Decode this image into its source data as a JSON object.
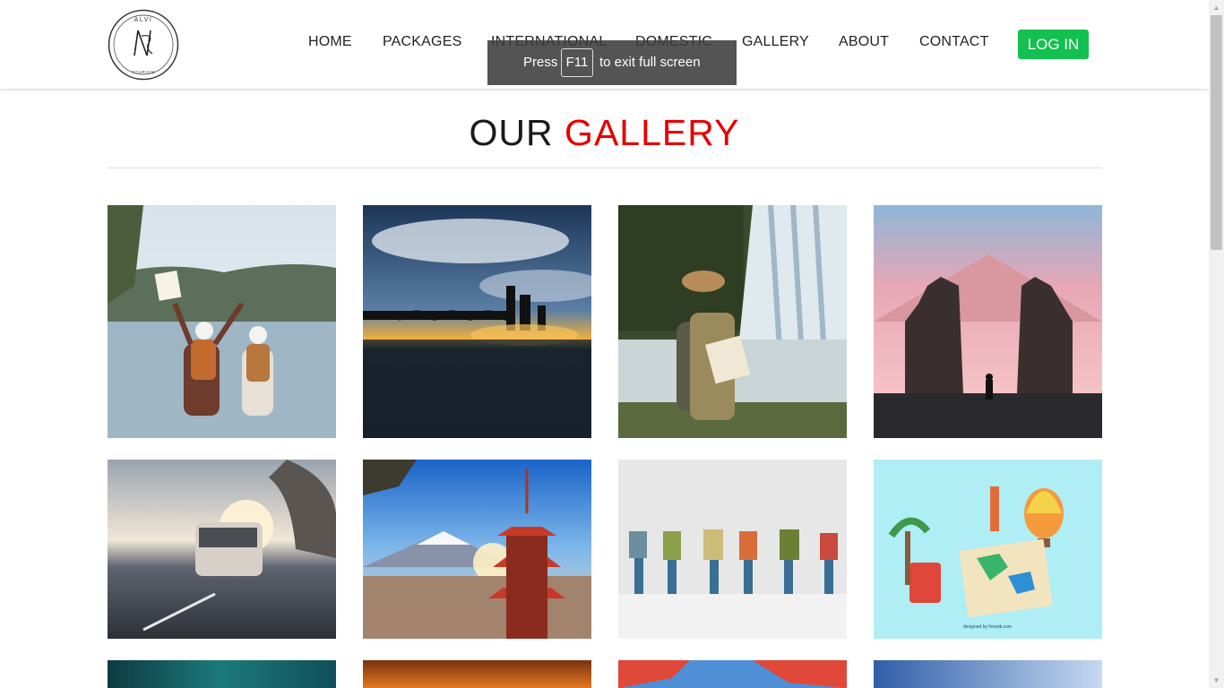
{
  "brand": {
    "logo_top_text": "ALVI",
    "logo_bottom_text": "TOURISM"
  },
  "nav": {
    "items": [
      {
        "label": "HOME"
      },
      {
        "label": "PACKAGES"
      },
      {
        "label": "INTERNATIONAL"
      },
      {
        "label": "DOMESTIC"
      },
      {
        "label": "GALLERY"
      },
      {
        "label": "ABOUT"
      },
      {
        "label": "CONTACT"
      }
    ],
    "login_label": "LOG IN"
  },
  "fullscreen_toast": {
    "press": "Press",
    "key": "F11",
    "suffix": "to exit full screen"
  },
  "gallery": {
    "title_part1": "OUR",
    "title_part2": "GALLERY",
    "images": [
      {
        "name": "hikers-lake-photo",
        "subject": "travelers-with-backpacks-at-lake"
      },
      {
        "name": "city-sunset-photo",
        "subject": "city-bridge-sunset"
      },
      {
        "name": "waterfall-traveler-photo",
        "subject": "traveler-with-map-at-waterfall"
      },
      {
        "name": "temple-gate-photo",
        "subject": "temple-gate-at-sunrise"
      },
      {
        "name": "tour-bus-photo",
        "subject": "tour-bus-on-highway"
      },
      {
        "name": "pagoda-photo",
        "subject": "pagoda-with-mountain"
      },
      {
        "name": "miniature-backpackers-photo",
        "subject": "miniature-backpacker-figures"
      },
      {
        "name": "travel-illustration",
        "subject": "travel-illustration-map-and-balloon"
      },
      {
        "name": "aurora-photo",
        "subject": "teal-sky"
      },
      {
        "name": "warm-interior-photo",
        "subject": "orange-interior"
      },
      {
        "name": "autumn-trees-photo",
        "subject": "red-autumn-leaves"
      },
      {
        "name": "blue-sky-photo",
        "subject": "blue-sky-landscape"
      }
    ]
  },
  "colors": {
    "accent_red": "#e60000",
    "login_green": "#12c14f",
    "nav_text": "#222222"
  }
}
